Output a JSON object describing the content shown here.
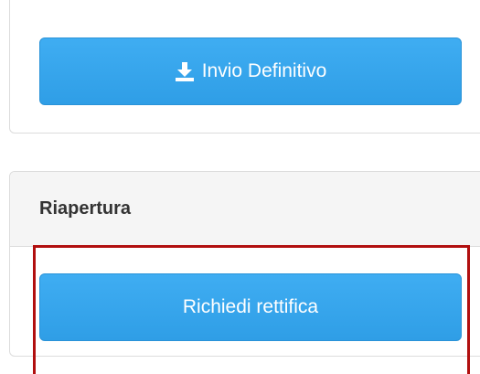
{
  "top_panel": {
    "button_label": "Invio Definitivo",
    "button_icon": "download-icon"
  },
  "riapertura_panel": {
    "title": "Riapertura",
    "button_label": "Richiedi rettifica"
  },
  "colors": {
    "button_blue": "#3aa8ef",
    "highlight_red": "#b10f0f"
  }
}
